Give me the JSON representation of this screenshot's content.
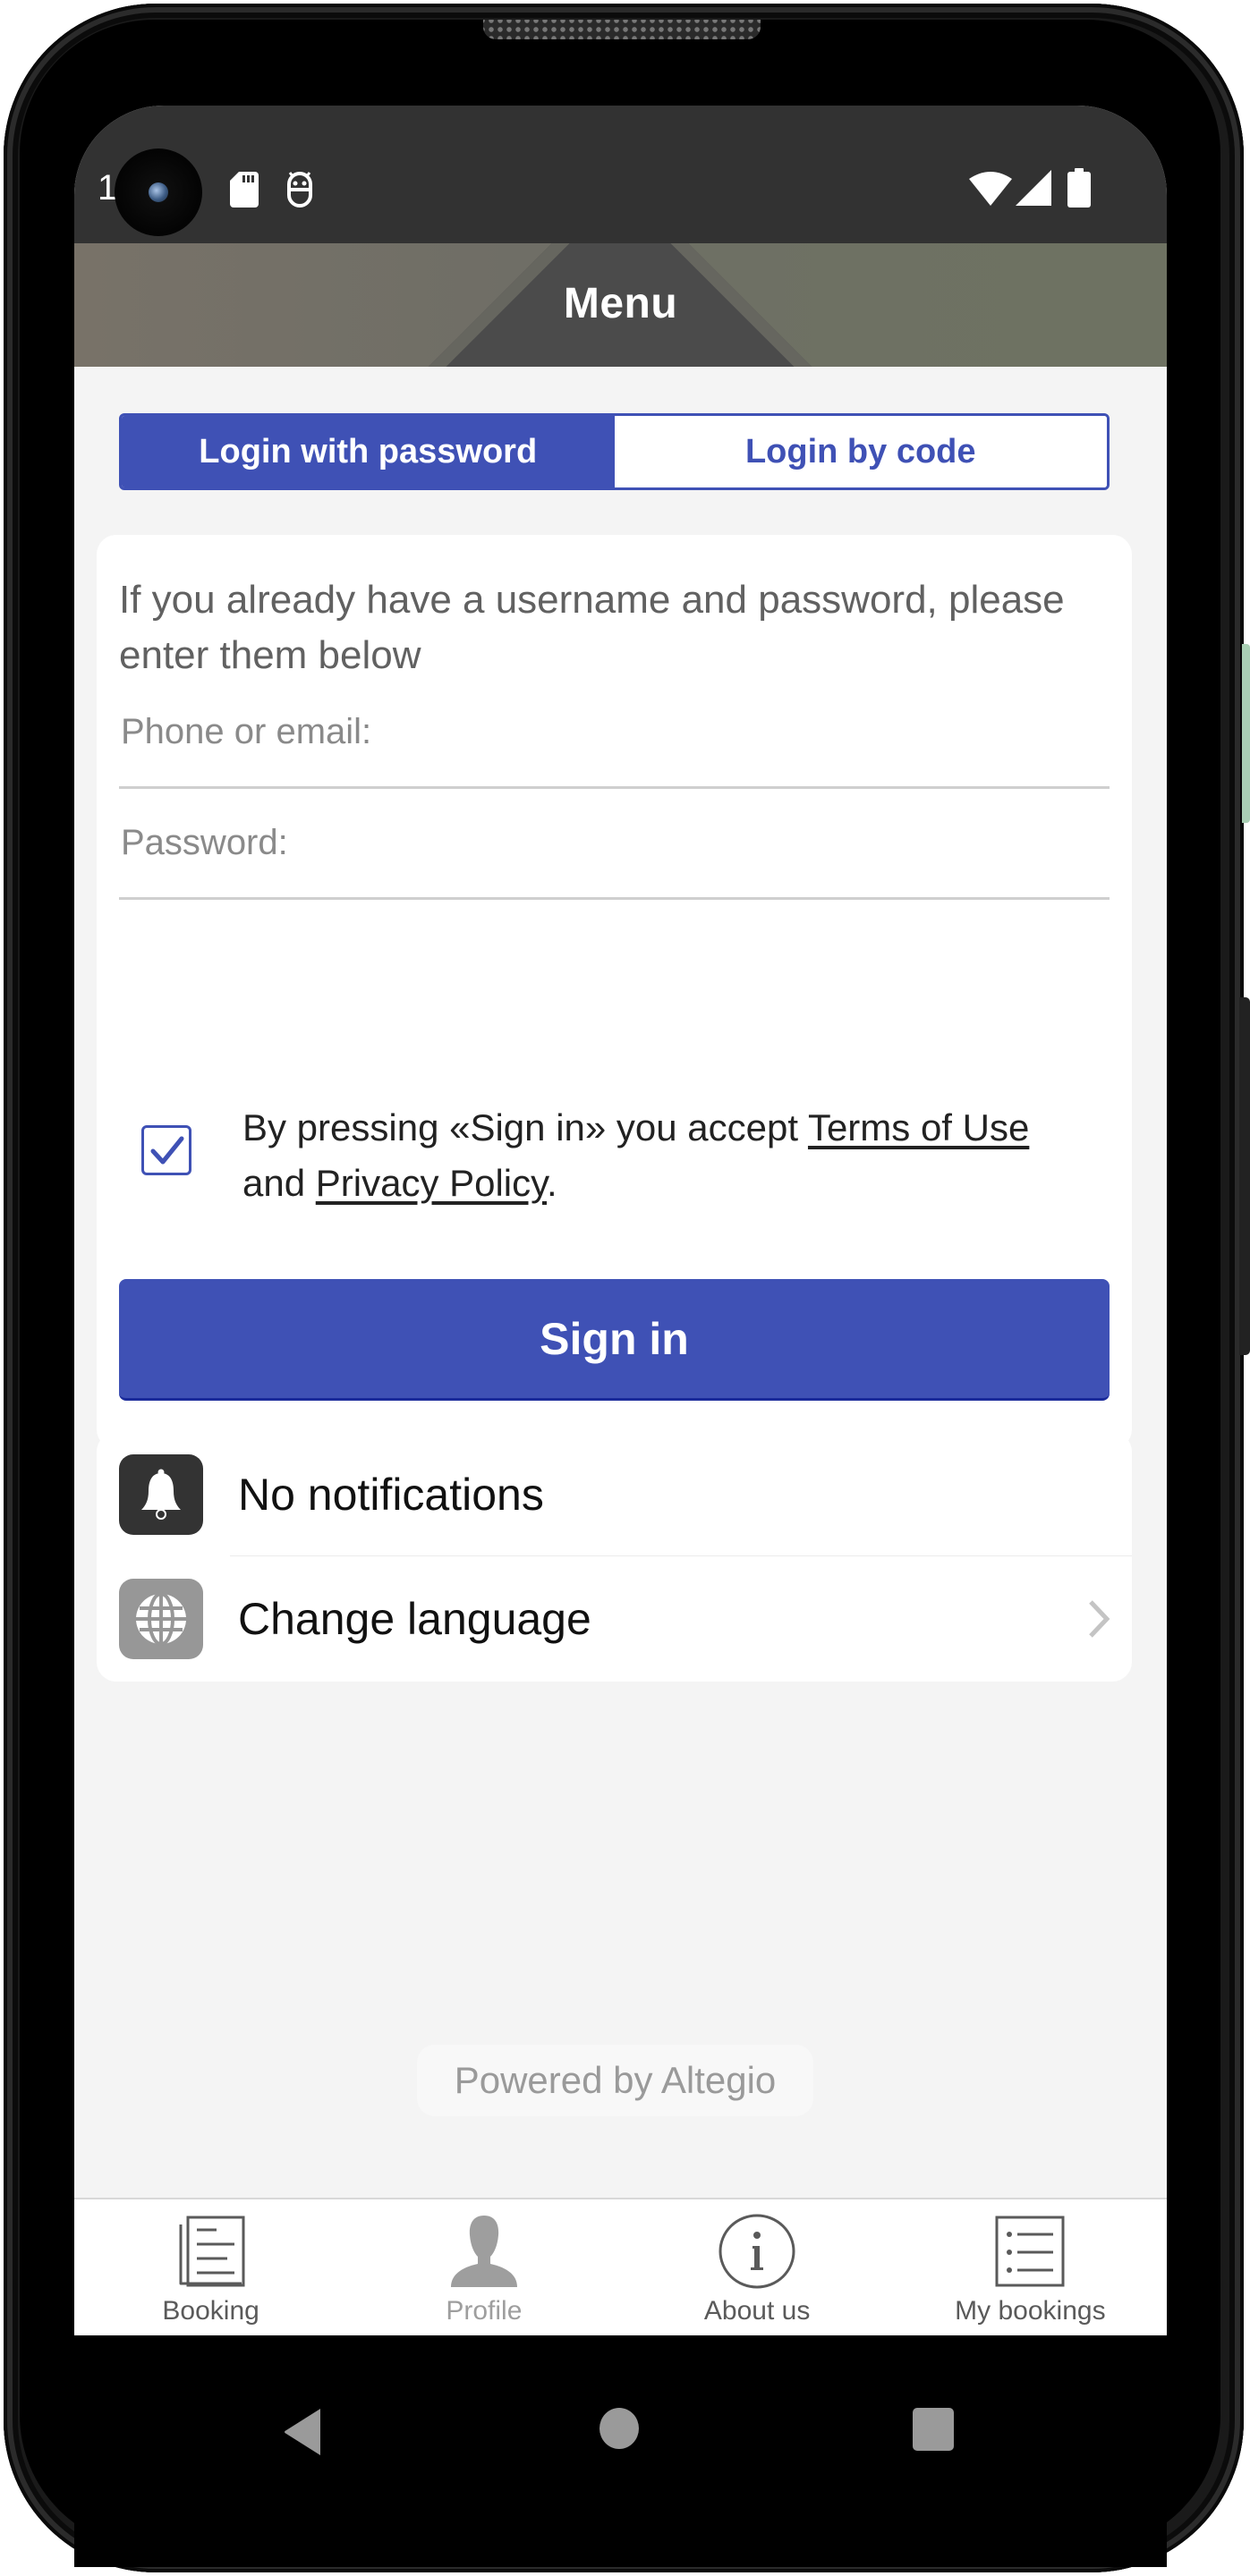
{
  "status_bar": {
    "time": "1",
    "left_icons": [
      "sd-card-icon",
      "robot-icon"
    ],
    "right_icons": [
      "wifi-icon",
      "signal-icon",
      "battery-icon"
    ]
  },
  "header": {
    "title": "Menu"
  },
  "login_tabs": [
    {
      "label": "Login with password",
      "active": true
    },
    {
      "label": "Login by code",
      "active": false
    }
  ],
  "login_form": {
    "intro": "If you already have a username and password, please enter them below",
    "phone_field": {
      "placeholder": "Phone or email:",
      "value": ""
    },
    "password_field": {
      "placeholder": "Password:",
      "value": ""
    },
    "consent": {
      "checked": true,
      "prefix": "By pressing «Sign in» you accept ",
      "terms_link": "Terms of Use",
      "middle": " and ",
      "privacy_link": "Privacy Policy",
      "suffix": "."
    },
    "submit_label": "Sign in"
  },
  "menu_items": [
    {
      "label": "No notifications",
      "icon": "bell-icon",
      "has_chevron": false
    },
    {
      "label": "Change language",
      "icon": "globe-icon",
      "has_chevron": true
    }
  ],
  "footer": {
    "powered_by": "Powered by Altegio"
  },
  "tab_bar": [
    {
      "label": "Booking",
      "icon": "booking-document-icon",
      "muted": false
    },
    {
      "label": "Profile",
      "icon": "profile-person-icon",
      "muted": true
    },
    {
      "label": "About us",
      "icon": "info-icon",
      "muted": false
    },
    {
      "label": "My bookings",
      "icon": "list-icon",
      "muted": false
    }
  ],
  "colors": {
    "accent": "#3f51b5",
    "status_bar": "#323232",
    "content_bg": "#f4f4f4",
    "card_bg": "#ffffff",
    "tab_text": "#5a5a5a",
    "muted_text": "#9e9e9e"
  }
}
